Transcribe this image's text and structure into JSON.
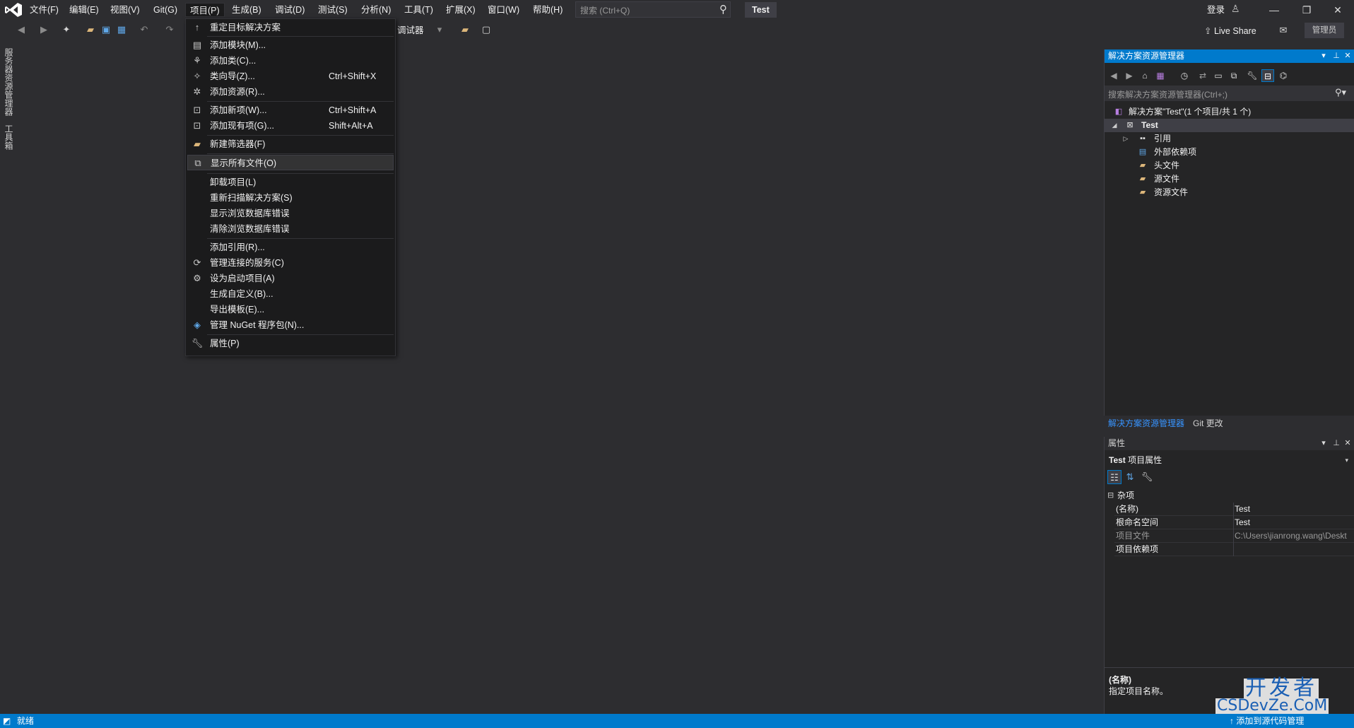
{
  "menubar": {
    "items": [
      "文件(F)",
      "编辑(E)",
      "视图(V)",
      "Git(G)",
      "项目(P)",
      "生成(B)",
      "调试(D)",
      "测试(S)",
      "分析(N)",
      "工具(T)",
      "扩展(X)",
      "窗口(W)",
      "帮助(H)"
    ],
    "search_placeholder": "搜索 (Ctrl+Q)",
    "solution_name": "Test",
    "signin": "登录",
    "window_buttons": [
      "minimize-icon",
      "restore-icon",
      "close-icon"
    ]
  },
  "toolbar": {
    "debugger_label": "调试器",
    "liveshare": "Live Share",
    "admin_badge": "管理员"
  },
  "left_rail": {
    "tabs": [
      "服务器资源管理器",
      "工具箱"
    ]
  },
  "project_menu": {
    "items": [
      {
        "label": "重定目标解决方案",
        "shortcut": "",
        "icon": "arrow-up-icon"
      },
      {
        "label": "添加模块(M)...",
        "shortcut": "",
        "icon": "module-icon"
      },
      {
        "label": "添加类(C)...",
        "shortcut": "",
        "icon": "add-class-icon"
      },
      {
        "label": "类向导(Z)...",
        "shortcut": "Ctrl+Shift+X",
        "icon": "class-wizard-icon"
      },
      {
        "label": "添加资源(R)...",
        "shortcut": "",
        "icon": "add-resource-icon"
      },
      {
        "label": "添加新项(W)...",
        "shortcut": "Ctrl+Shift+A",
        "icon": "add-new-item-icon"
      },
      {
        "label": "添加现有项(G)...",
        "shortcut": "Shift+Alt+A",
        "icon": "add-existing-item-icon"
      },
      {
        "label": "新建筛选器(F)",
        "shortcut": "",
        "icon": "new-filter-icon"
      },
      {
        "label": "显示所有文件(O)",
        "shortcut": "",
        "icon": "show-all-files-icon"
      },
      {
        "label": "卸载项目(L)",
        "shortcut": "",
        "icon": ""
      },
      {
        "label": "重新扫描解决方案(S)",
        "shortcut": "",
        "icon": ""
      },
      {
        "label": "显示浏览数据库错误",
        "shortcut": "",
        "icon": ""
      },
      {
        "label": "清除浏览数据库错误",
        "shortcut": "",
        "icon": ""
      },
      {
        "label": "添加引用(R)...",
        "shortcut": "",
        "icon": ""
      },
      {
        "label": "管理连接的服务(C)",
        "shortcut": "",
        "icon": "connected-services-icon"
      },
      {
        "label": "设为启动项目(A)",
        "shortcut": "",
        "icon": "gear-icon"
      },
      {
        "label": "生成自定义(B)...",
        "shortcut": "",
        "icon": ""
      },
      {
        "label": "导出模板(E)...",
        "shortcut": "",
        "icon": ""
      },
      {
        "label": "管理 NuGet 程序包(N)...",
        "shortcut": "",
        "icon": "nuget-icon"
      },
      {
        "label": "属性(P)",
        "shortcut": "",
        "icon": "wrench-icon"
      }
    ]
  },
  "solution_explorer": {
    "title": "解决方案资源管理器",
    "search_placeholder": "搜索解决方案资源管理器(Ctrl+;)",
    "tree": [
      {
        "label": "解决方案\"Test\"(1 个项目/共 1 个)",
        "level": 0,
        "icon": "solution-icon"
      },
      {
        "label": "Test",
        "level": 1,
        "icon": "project-icon"
      },
      {
        "label": "引用",
        "level": 2,
        "icon": "references-icon"
      },
      {
        "label": "外部依赖项",
        "level": 2,
        "icon": "external-deps-icon"
      },
      {
        "label": "头文件",
        "level": 2,
        "icon": "filter-folder-icon"
      },
      {
        "label": "源文件",
        "level": 2,
        "icon": "filter-folder-icon"
      },
      {
        "label": "资源文件",
        "level": 2,
        "icon": "filter-folder-icon"
      }
    ],
    "tabs": [
      "解决方案资源管理器",
      "Git 更改"
    ]
  },
  "properties": {
    "title": "属性",
    "object_name": "Test",
    "object_type": "项目属性",
    "category": "杂项",
    "rows": [
      {
        "name": "(名称)",
        "value": "Test"
      },
      {
        "name": "根命名空间",
        "value": "Test"
      },
      {
        "name": "项目文件",
        "value": "C:\\Users\\jianrong.wang\\Deskt"
      },
      {
        "name": "项目依赖项",
        "value": ""
      }
    ],
    "desc_title": "(名称)",
    "desc_text": "指定项目名称。"
  },
  "statusbar": {
    "text": "就绪",
    "right": "添加到源代码管理"
  },
  "watermark": {
    "big": "开发者",
    "small": "CSDevZe.CoM"
  },
  "colors": {
    "accent": "#007acc",
    "background": "#2d2d30",
    "menu_bg": "#1b1b1c"
  }
}
